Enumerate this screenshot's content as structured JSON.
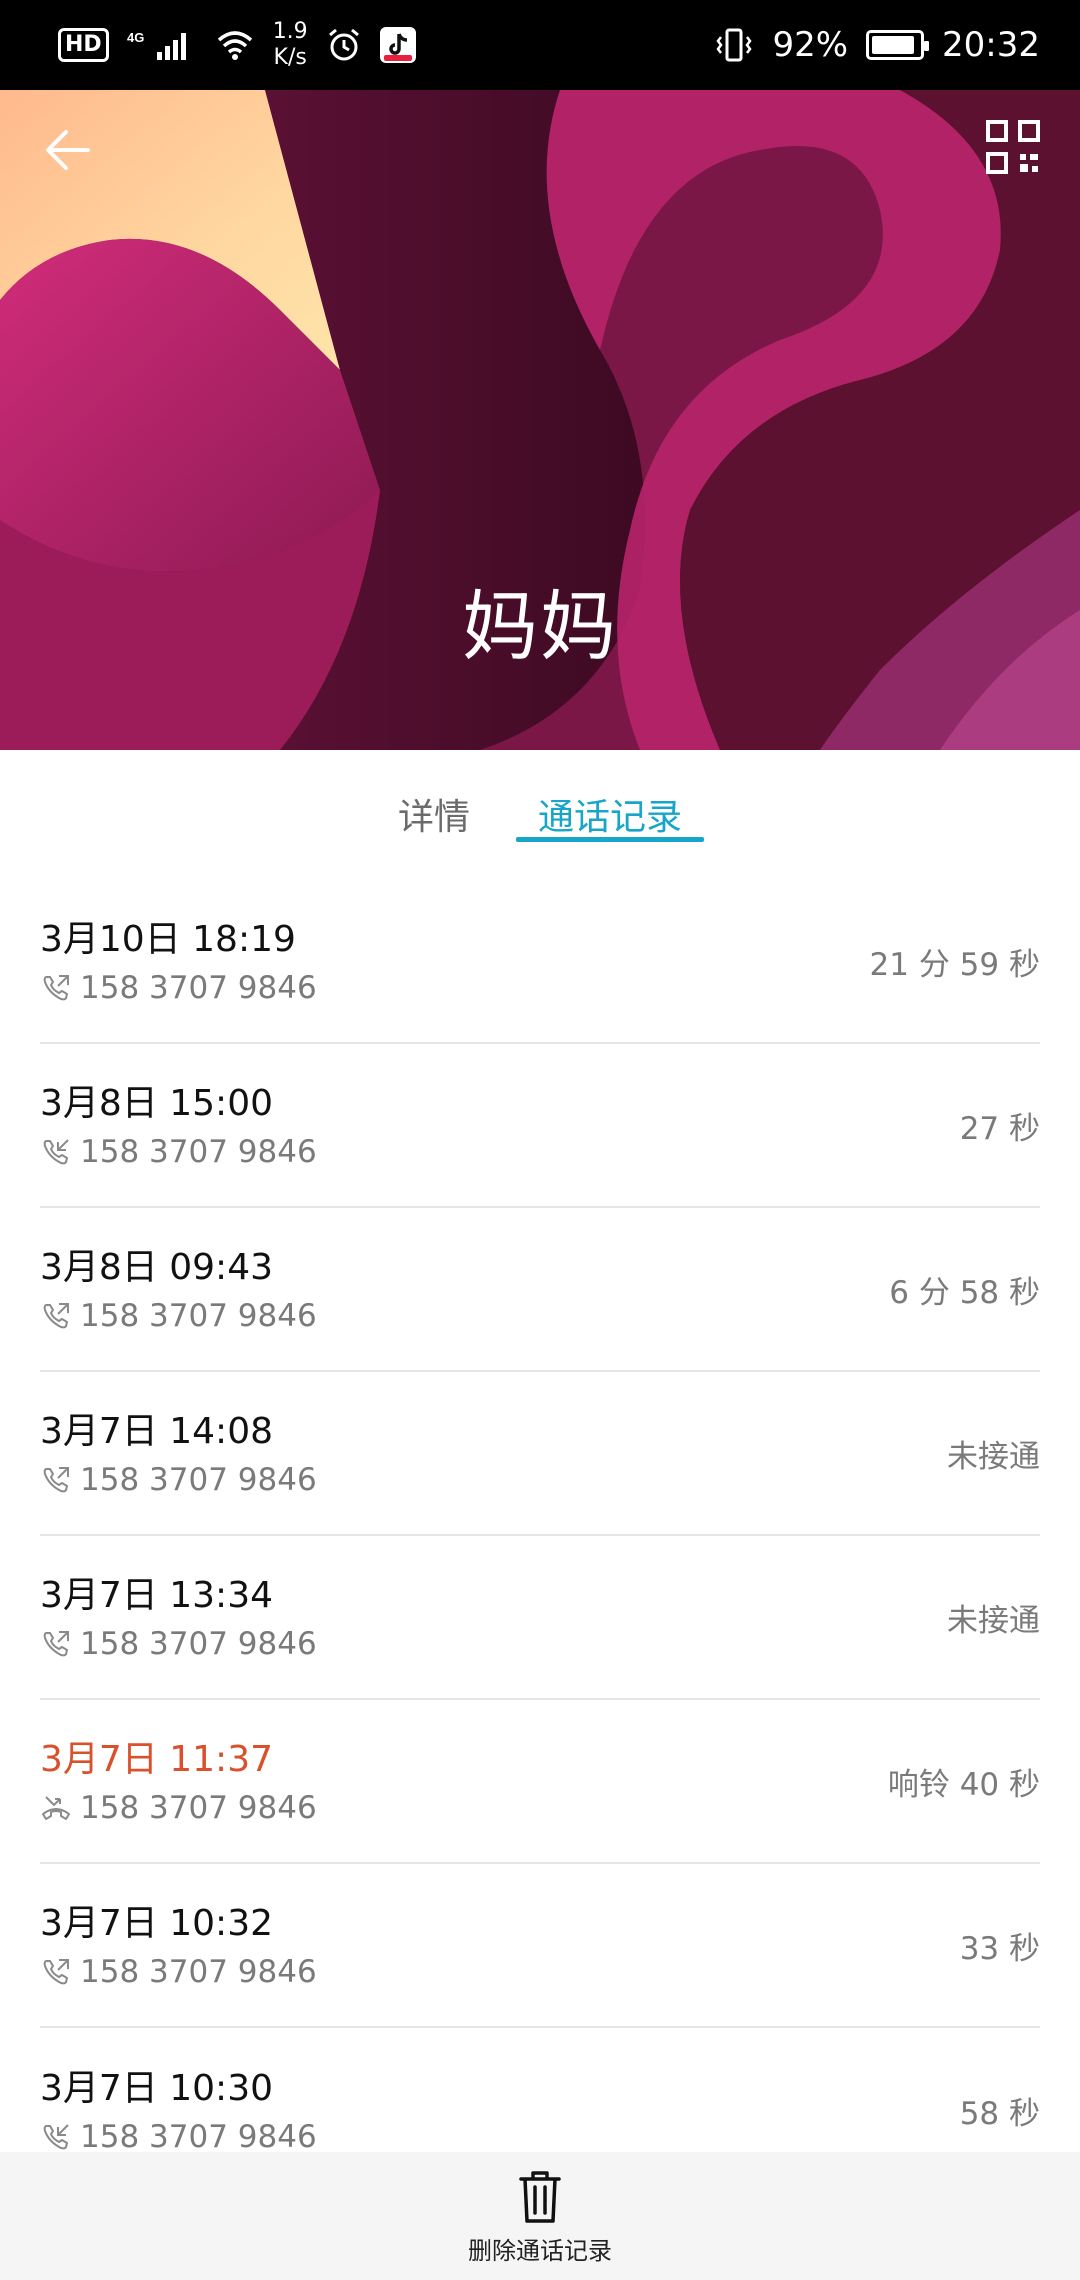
{
  "status_bar": {
    "hd": "HD",
    "network": "4G",
    "speed_value": "1.9",
    "speed_unit": "K/s",
    "battery": "92%",
    "battery_level": 0.92,
    "time": "20:32"
  },
  "hero": {
    "contact_name": "妈妈",
    "back_icon": "arrow-left-icon",
    "qr_icon": "qr-code-icon"
  },
  "tabs": [
    {
      "label": "详情",
      "active": false
    },
    {
      "label": "通话记录",
      "active": true
    }
  ],
  "colors": {
    "accent": "#17a5c9",
    "missed": "#d9502b",
    "secondary_text": "#7a7a7a",
    "status_bar": "#000000"
  },
  "calls": [
    {
      "time": "3月10日 18:19",
      "type": "outgoing",
      "number": "158 3707 9846",
      "duration": "21 分 59 秒"
    },
    {
      "time": "3月8日 15:00",
      "type": "incoming",
      "number": "158 3707 9846",
      "duration": "27 秒"
    },
    {
      "time": "3月8日 09:43",
      "type": "outgoing",
      "number": "158 3707 9846",
      "duration": "6 分 58 秒"
    },
    {
      "time": "3月7日 14:08",
      "type": "outgoing",
      "number": "158 3707 9846",
      "duration": "未接通"
    },
    {
      "time": "3月7日 13:34",
      "type": "outgoing",
      "number": "158 3707 9846",
      "duration": "未接通"
    },
    {
      "time": "3月7日 11:37",
      "type": "missed",
      "number": "158 3707 9846",
      "duration": "响铃 40 秒"
    },
    {
      "time": "3月7日 10:32",
      "type": "outgoing",
      "number": "158 3707 9846",
      "duration": "33 秒"
    },
    {
      "time": "3月7日 10:30",
      "type": "incoming",
      "number": "158 3707 9846",
      "duration": "58 秒"
    }
  ],
  "bottom_bar": {
    "delete_label": "删除通话记录",
    "delete_icon": "trash-icon"
  }
}
